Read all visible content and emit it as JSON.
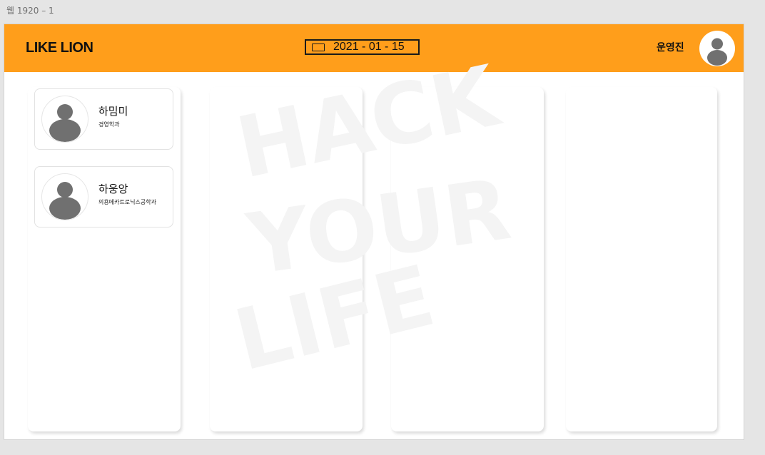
{
  "canvas": {
    "label": "웹 1920 – 1"
  },
  "header": {
    "logo": "LIKE LION",
    "date": "2021 - 01 - 15",
    "user_name": "운영진",
    "background": "#ff9e1b"
  },
  "watermark": {
    "lines": [
      "HACK",
      "YOUR",
      "LIFE"
    ]
  },
  "members": [
    {
      "name": "하밈미",
      "department": "경영학과"
    },
    {
      "name": "하웅앙",
      "department": "의용메카트로닉스공학과"
    }
  ],
  "icons": {
    "avatar": "person-silhouette-icon",
    "date": "calendar-icon"
  },
  "colors": {
    "accent": "#ff9e1b",
    "avatar_fill": "#707070"
  }
}
